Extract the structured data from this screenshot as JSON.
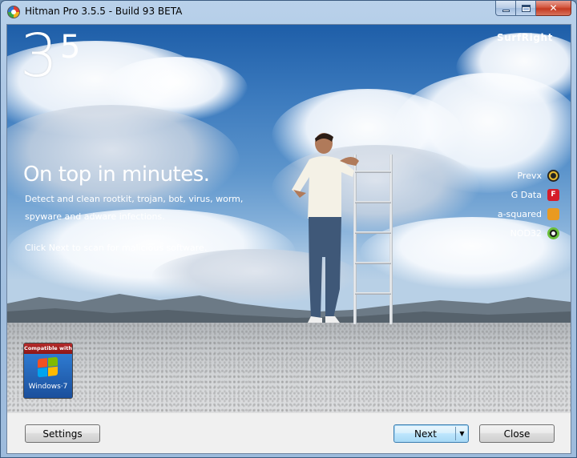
{
  "window": {
    "title": "Hitman Pro 3.5.5 - Build 93 BETA",
    "minimize_icon": "minimize-icon",
    "maximize_icon": "maximize-icon",
    "close_icon": "close-icon",
    "close_glyph": "✕"
  },
  "hero": {
    "version_major": "3",
    "version_minor": "5",
    "brand": "SurfRight",
    "headline": "On top in minutes.",
    "description": "Detect and clean rootkit, trojan, bot, virus, worm, spyware and adware infections.",
    "hint": "Click Next to scan for malicious software.",
    "engines": [
      {
        "label": "Prevx",
        "icon": "prevx-icon"
      },
      {
        "label": "G Data",
        "icon": "gdata-icon",
        "glyph": "F"
      },
      {
        "label": "a-squared",
        "icon": "a-squared-icon",
        "glyph": ""
      },
      {
        "label": "NOD32",
        "icon": "nod32-icon"
      }
    ],
    "badge": {
      "top_text": "Compatible with",
      "bottom_text": "Windows·7"
    }
  },
  "buttons": {
    "settings": "Settings",
    "next": "Next",
    "next_dropdown_glyph": "▼",
    "close": "Close"
  },
  "colors": {
    "sky_top": "#1e5ea8",
    "ground": "#c6c9cc",
    "next_button_accent": "#3c7fb1"
  }
}
